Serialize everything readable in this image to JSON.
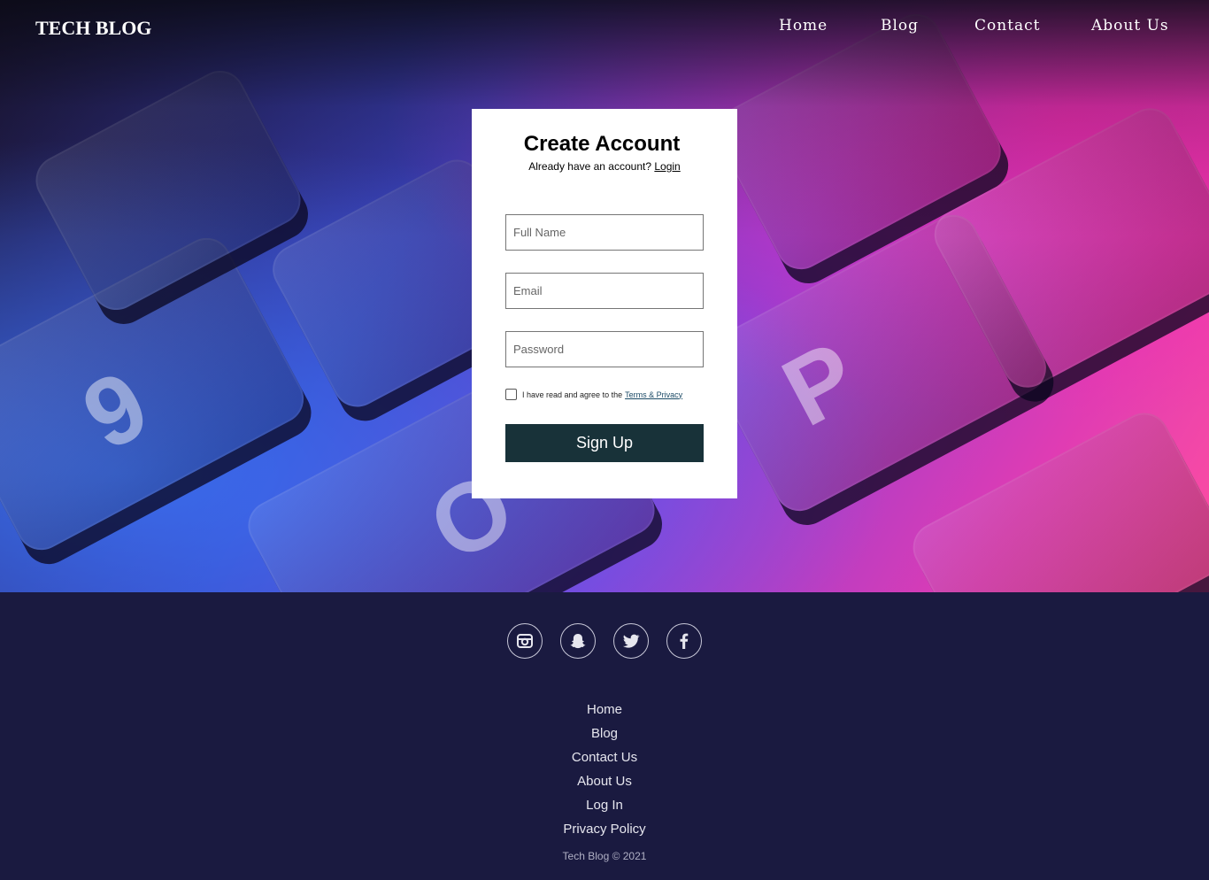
{
  "header": {
    "brand": "TECH BLOG",
    "nav": [
      "Home",
      "Blog",
      "Contact",
      "About Us"
    ]
  },
  "signup_form": {
    "title": "Create Account",
    "login_prompt": "Already have an account?",
    "login_link": "Login",
    "fields": {
      "full_name_placeholder": "Full Name",
      "email_placeholder": "Email",
      "password_placeholder": "Password"
    },
    "agree_text": "I have read and agree to the",
    "terms_link": "Terms & Privacy",
    "submit_label": "Sign Up"
  },
  "footer": {
    "socials": [
      "instagram-icon",
      "snapchat-icon",
      "twitter-icon",
      "facebook-icon"
    ],
    "links": [
      "Home",
      "Blog",
      "Contact Us",
      "About Us",
      "Log In",
      "Privacy Policy"
    ],
    "copyright": "Tech Blog © 2021"
  },
  "colors": {
    "footer_bg": "#1a1a40",
    "button_bg": "#183239",
    "card_bg": "#ffffff"
  }
}
